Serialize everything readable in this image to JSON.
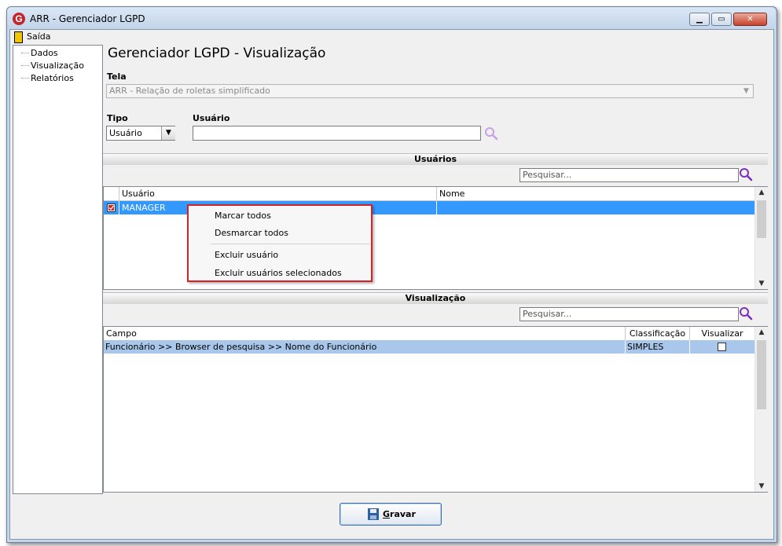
{
  "window": {
    "title": "ARR - Gerenciador LGPD",
    "icon_letter": "G",
    "icon": "app-logo-icon"
  },
  "menu": {
    "exit_label": "Saída"
  },
  "sidebar": {
    "items": [
      "Dados",
      "Visualização",
      "Relatórios"
    ]
  },
  "page": {
    "title": "Gerenciador LGPD - Visualização"
  },
  "tela": {
    "label": "Tela",
    "value": "ARR -  Relação de roletas simplificado"
  },
  "tipo": {
    "label": "Tipo",
    "value": "Usuário"
  },
  "usuario": {
    "label": "Usuário",
    "value": ""
  },
  "usuarios_section": {
    "title": "Usuários",
    "search_placeholder": "Pesquisar...",
    "columns": [
      "Usuário",
      "Nome"
    ],
    "rows": [
      {
        "usuario": "MANAGER",
        "nome": "",
        "checked": true
      }
    ]
  },
  "context_menu": {
    "items": [
      "Marcar todos",
      "Desmarcar todos",
      "Excluir usuário",
      "Excluir usuários selecionados"
    ]
  },
  "visualizacao_section": {
    "title": "Visualização",
    "search_placeholder": "Pesquisar...",
    "columns": [
      "Campo",
      "Classificação",
      "Visualizar"
    ],
    "rows": [
      {
        "campo": "Funcionário >> Browser de pesquisa >> Nome do Funcionário",
        "classificacao": "SIMPLES",
        "visualizar": false
      }
    ]
  },
  "footer": {
    "save_label": "Gravar"
  },
  "colors": {
    "selection": "#3399ff",
    "row_highlight": "#a9c7ea",
    "search_icon": "#7b2fbf",
    "accent_red": "#d1222a"
  }
}
